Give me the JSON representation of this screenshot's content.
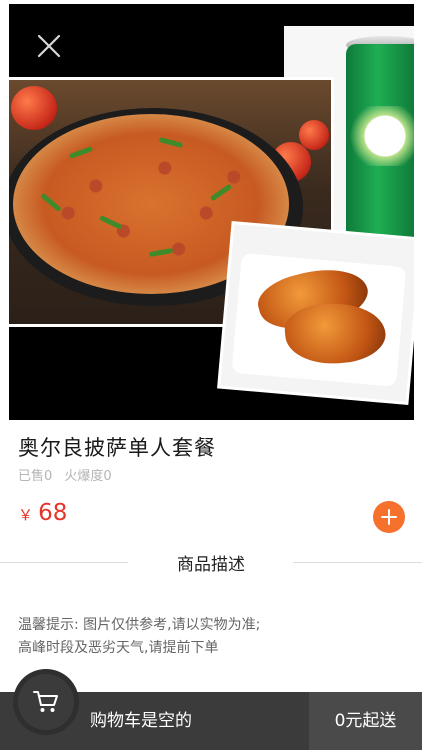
{
  "product": {
    "name": "奥尔良披萨单人套餐",
    "sold_label": "已售0",
    "popularity_label": "火爆度0",
    "price_symbol": "￥",
    "price": "68"
  },
  "description": {
    "heading": "商品描述",
    "line1": "温馨提示: 图片仅供参考,请以实物为准;",
    "line2": "高峰时段及恶劣天气,请提前下单"
  },
  "cart": {
    "status_text": "购物车是空的",
    "checkout_label": "0元起送"
  },
  "icons": {
    "close": "close-icon",
    "add": "plus-icon",
    "cart": "shopping-cart-icon"
  },
  "colors": {
    "price": "#e5352b",
    "add_button": "#f5712c",
    "cart_bar": "#3b3b3b"
  }
}
